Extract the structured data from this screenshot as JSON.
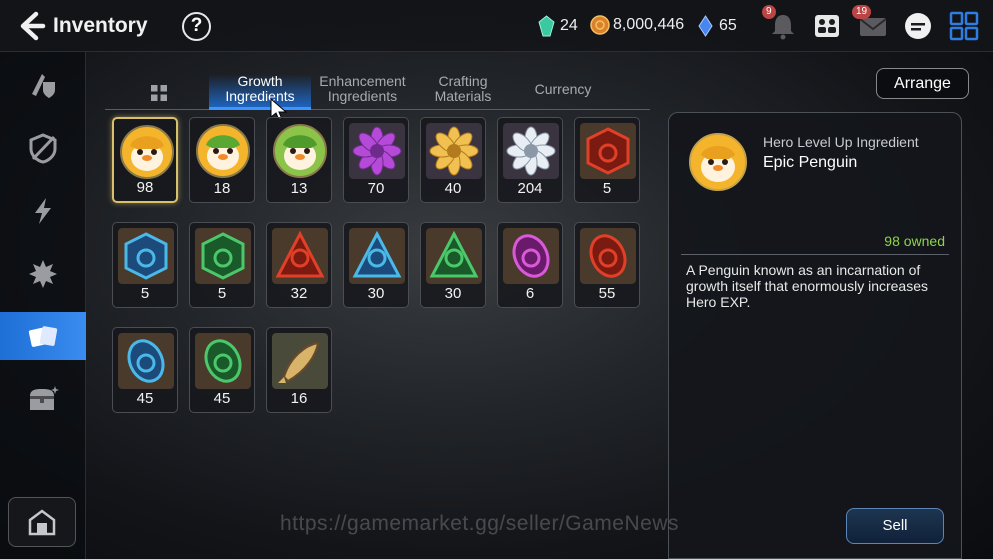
{
  "header": {
    "title": "Inventory",
    "help_label": "?",
    "resources": [
      {
        "name": "crystal",
        "value": "24",
        "icon": "crystal-icon",
        "color": "#3ac9a0"
      },
      {
        "name": "gold",
        "value": "8,000,446",
        "icon": "gold-coin-icon",
        "color": "#e0902a"
      },
      {
        "name": "stamina",
        "value": "65",
        "icon": "energy-icon",
        "color": "#5a9cff"
      }
    ],
    "notifications": {
      "alarm_badge": "9",
      "mail_badge": "19"
    }
  },
  "tabs": [
    {
      "label_line1": "Growth",
      "label_line2": "Ingredients",
      "active": true
    },
    {
      "label_line1": "Enhancement",
      "label_line2": "Ingredients",
      "active": false
    },
    {
      "label_line1": "Crafting",
      "label_line2": "Materials",
      "active": false
    },
    {
      "label_line1": "Currency",
      "label_line2": "",
      "active": false
    }
  ],
  "arrange_label": "Arrange",
  "items": [
    {
      "qty": "98",
      "kind": "penguin-gold",
      "icon": "epic-penguin-icon",
      "selected": true
    },
    {
      "qty": "18",
      "kind": "penguin-gold-green",
      "icon": "penguin-icon"
    },
    {
      "qty": "13",
      "kind": "penguin-green",
      "icon": "penguin-icon"
    },
    {
      "qty": "70",
      "kind": "flower-purple",
      "icon": "purple-flower-icon"
    },
    {
      "qty": "40",
      "kind": "flower-gold",
      "icon": "gold-flower-icon"
    },
    {
      "qty": "204",
      "kind": "flower-silver",
      "icon": "silver-flower-icon"
    },
    {
      "qty": "5",
      "kind": "rune-red-hex",
      "icon": "fire-rune-icon"
    },
    {
      "qty": "5",
      "kind": "rune-blue-hex",
      "icon": "ice-rune-icon"
    },
    {
      "qty": "5",
      "kind": "rune-green-hex",
      "icon": "earth-rune-icon"
    },
    {
      "qty": "32",
      "kind": "rune-red-tri",
      "icon": "fire-rune-icon"
    },
    {
      "qty": "30",
      "kind": "rune-blue-tri",
      "icon": "ice-rune-icon"
    },
    {
      "qty": "30",
      "kind": "rune-green-tri",
      "icon": "earth-rune-icon"
    },
    {
      "qty": "6",
      "kind": "rune-purple-oval",
      "icon": "dark-rune-icon"
    },
    {
      "qty": "55",
      "kind": "rune-red-oval",
      "icon": "fire-rune-icon"
    },
    {
      "qty": "45",
      "kind": "rune-blue-oval",
      "icon": "ice-rune-icon"
    },
    {
      "qty": "45",
      "kind": "rune-green-oval",
      "icon": "earth-rune-icon"
    },
    {
      "qty": "16",
      "kind": "fish",
      "icon": "fish-icon"
    }
  ],
  "detail": {
    "category": "Hero Level Up Ingredient",
    "name": "Epic Penguin",
    "owned": "98 owned",
    "description": "A Penguin known as an incarnation of growth itself that enormously increases Hero EXP.",
    "sell_label": "Sell"
  },
  "watermark": "https://gamemarket.gg/seller/GameNews",
  "sidebar": [
    "equipment-icon",
    "artifact-icon",
    "catalyst-icon",
    "spirit-icon",
    "material-icon",
    "chest-icon"
  ],
  "colors": {
    "accent": "#2a82f0",
    "owned": "#8fd34a",
    "selected_frame": "#d9c06a"
  }
}
